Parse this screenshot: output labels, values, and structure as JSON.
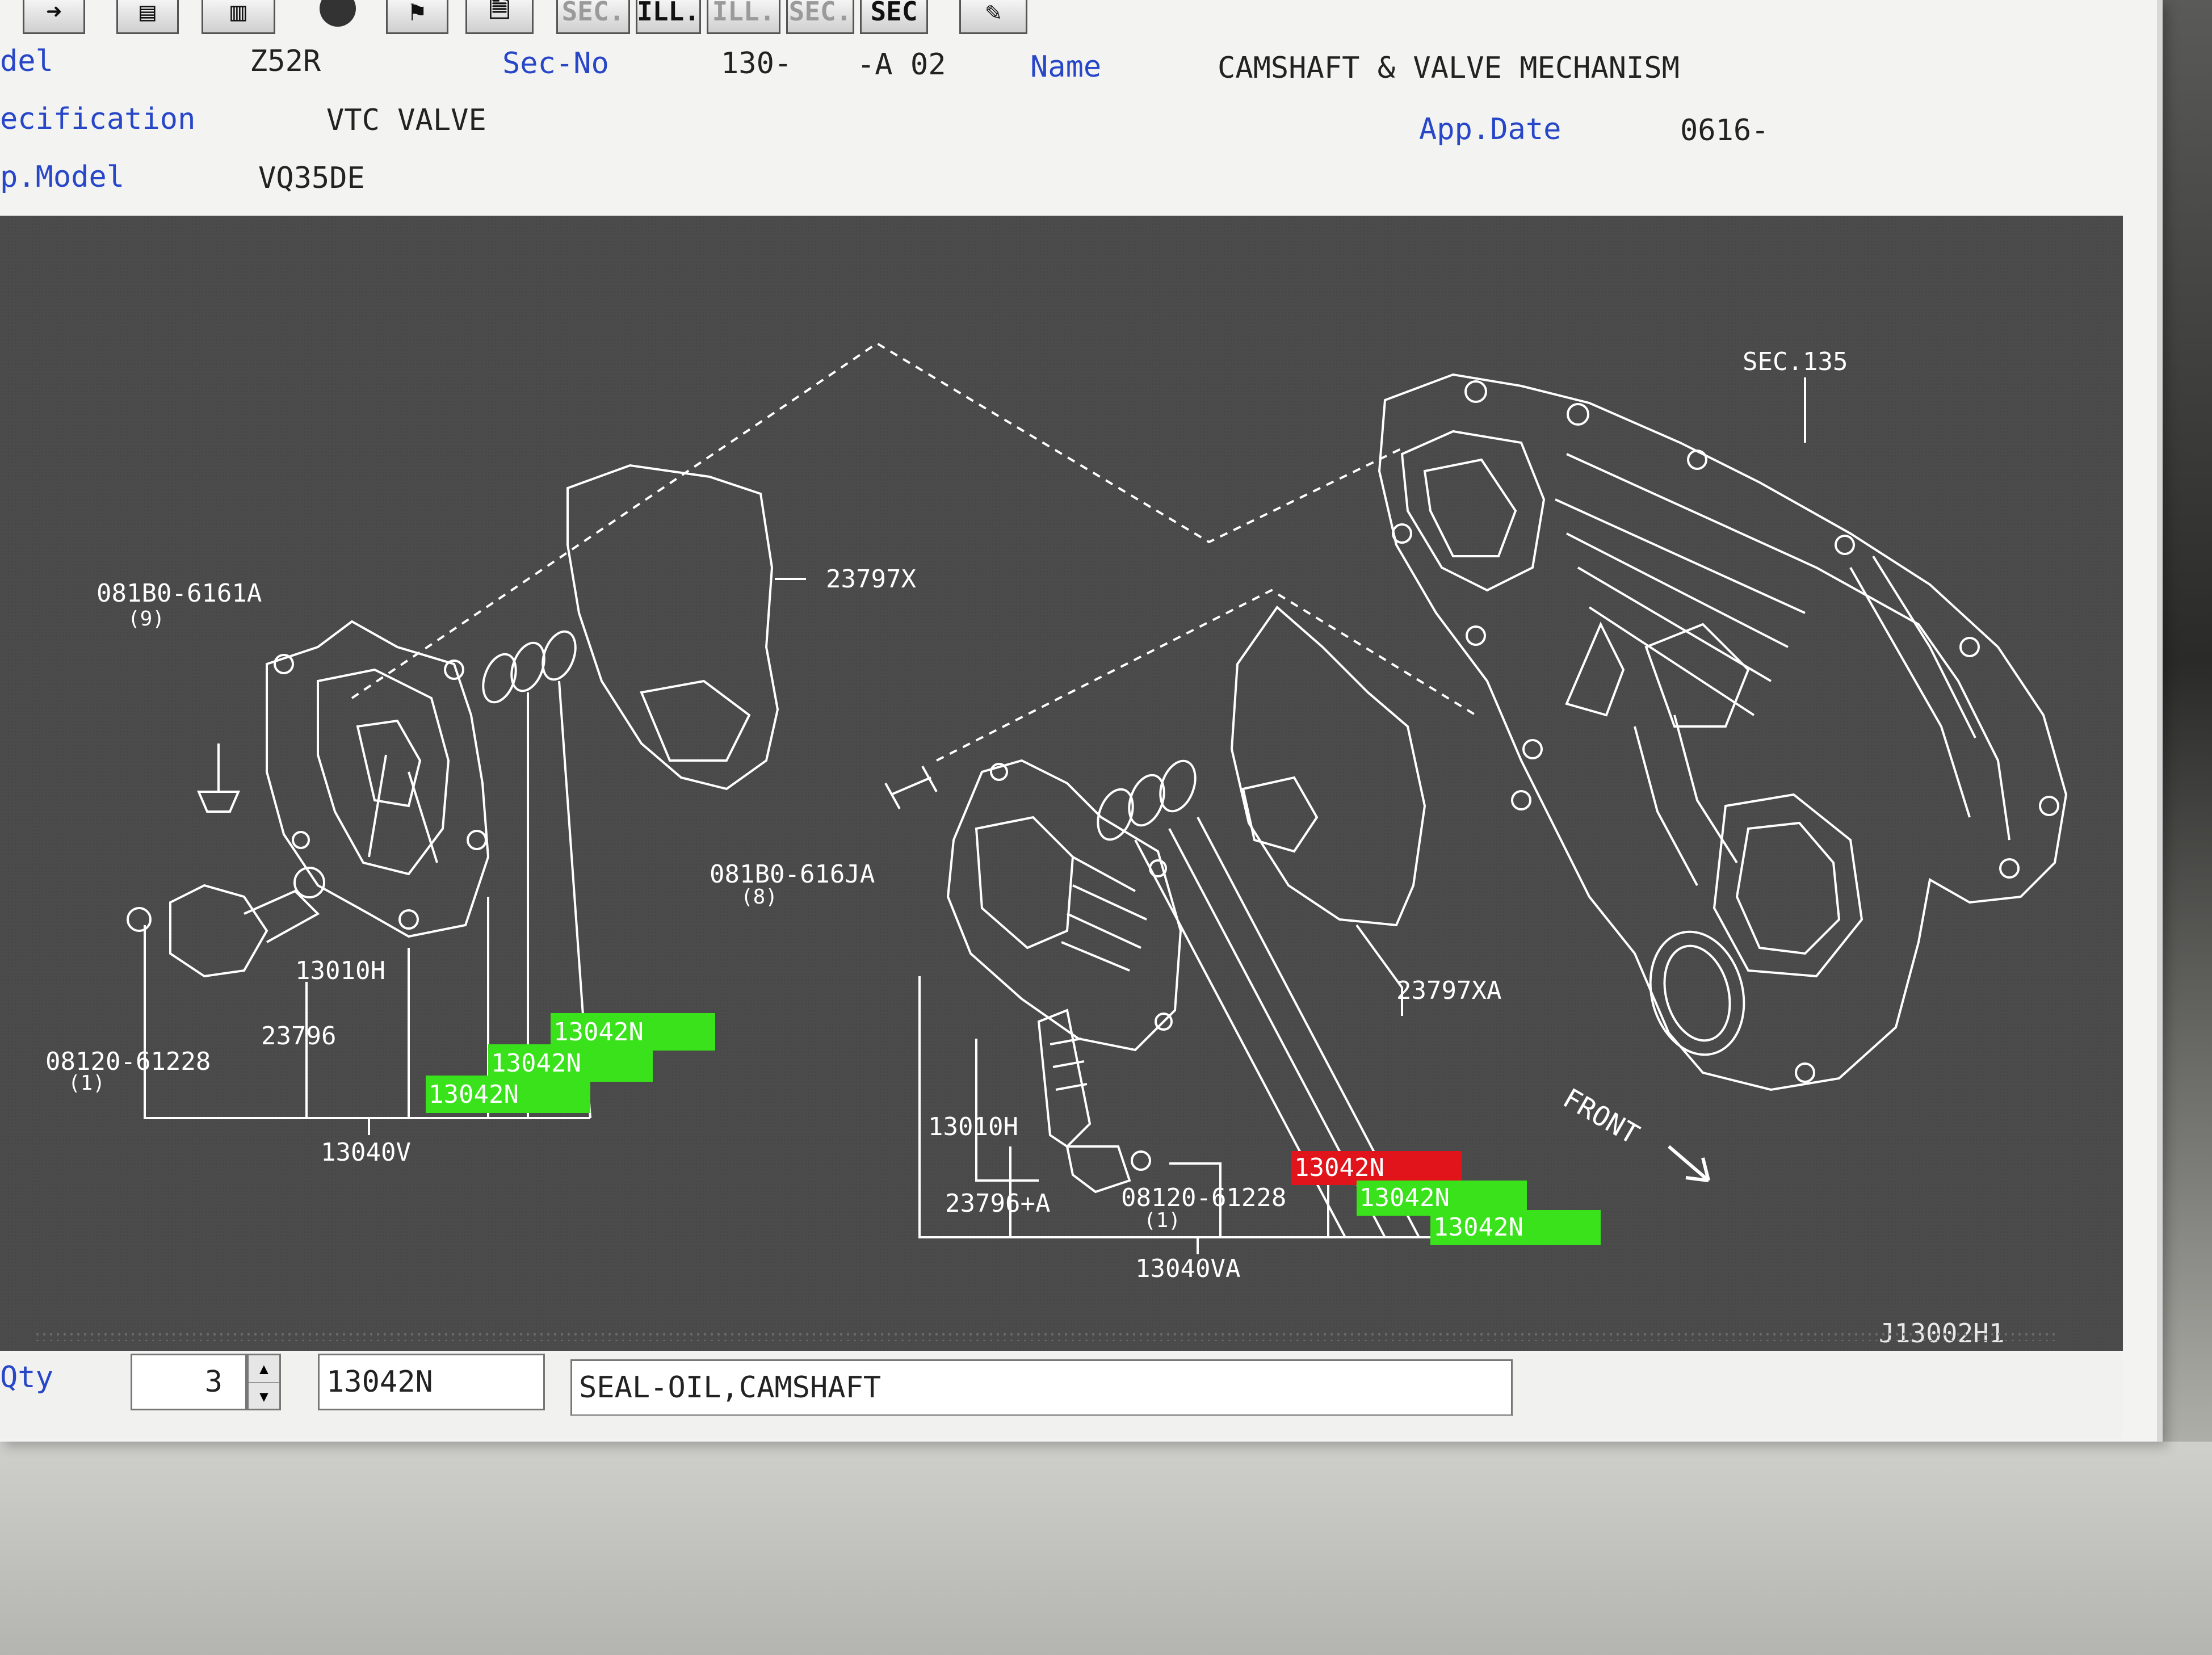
{
  "toolbar": {
    "buttons": [
      "SEC.",
      "ILL.",
      "ILL.",
      "SEC.",
      "SEC"
    ]
  },
  "header": {
    "model_label": "del",
    "model_value": "Z52R",
    "secno_label": "Sec-No",
    "secno_value": "130-",
    "secno_suffix": "-A 02",
    "name_label": "Name",
    "name_value": "CAMSHAFT & VALVE MECHANISM",
    "spec_label": "ecification",
    "spec_value": "VTC VALVE",
    "appdate_label": "App.Date",
    "appdate_value": "0616-",
    "engine_label": "p.Model",
    "engine_value": "VQ35DE"
  },
  "diagram": {
    "left": {
      "bolt_top": "081B0-6161A",
      "bolt_top_qty": "(9)",
      "gasket": "23797X",
      "solenoid": "13010H",
      "valve": "23796",
      "bolt_bottom": "08120-61228",
      "bolt_bottom_qty": "(1)",
      "cover_assy": "13040V",
      "seals": [
        "13042N",
        "13042N",
        "13042N"
      ]
    },
    "right": {
      "bolt_top": "081B0-616JA",
      "bolt_top_qty": "(8)",
      "gasket": "23797XA",
      "solenoid": "13010H",
      "valve": "23796+A",
      "bolt_bottom": "08120-61228",
      "bolt_bottom_qty": "(1)",
      "cover_assy": "13040VA",
      "seal_selected": "13042N",
      "seals": [
        "13042N",
        "13042N"
      ]
    },
    "sec_ref": "SEC.135",
    "front_label": "FRONT",
    "illustration_id": "J13002H1",
    "colors": {
      "background": "#4b4b4b",
      "linework": "#ffffff",
      "highlight": "#39e21a",
      "selected": "#e0141a"
    }
  },
  "bottom": {
    "qty_label": "Qty",
    "qty_value": "3",
    "part_number": "13042N",
    "description": "SEAL-OIL,CAMSHAFT"
  }
}
